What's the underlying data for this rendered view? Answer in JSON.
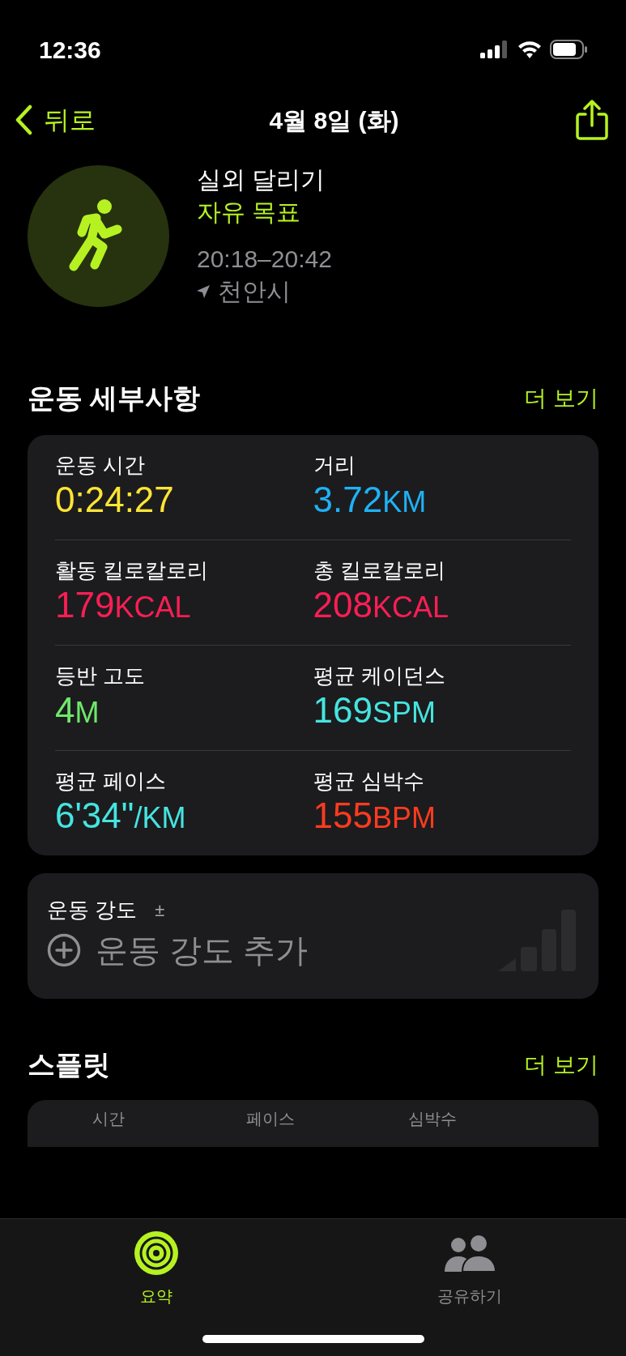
{
  "status_bar": {
    "time": "12:36"
  },
  "nav": {
    "back": "뒤로",
    "title": "4월 8일 (화)"
  },
  "workout": {
    "name": "실외 달리기",
    "goal": "자유 목표",
    "time_range": "20:18–20:42",
    "location": "천안시"
  },
  "details": {
    "title": "운동 세부사항",
    "more": "더 보기",
    "metrics": [
      {
        "label": "운동 시간",
        "value": "0:24:27",
        "color": "#ffe534"
      },
      {
        "label": "거리",
        "value": "3.72",
        "unit": "KM",
        "color": "#1fb2f5"
      },
      {
        "label": "활동 킬로칼로리",
        "value": "179",
        "unit": "KCAL",
        "color": "#fa1e54"
      },
      {
        "label": "총 킬로칼로리",
        "value": "208",
        "unit": "KCAL",
        "color": "#fa1e54"
      },
      {
        "label": "등반 고도",
        "value": "4",
        "unit": "M",
        "color": "#6fe86a"
      },
      {
        "label": "평균 케이던스",
        "value": "169",
        "unit": "SPM",
        "color": "#45e5e0"
      },
      {
        "label": "평균 페이스",
        "value": "6'34\"",
        "unit": "/KM",
        "color": "#45e5e0"
      },
      {
        "label": "평균 심박수",
        "value": "155",
        "unit": "BPM",
        "color": "#ff3b1f"
      }
    ]
  },
  "intensity": {
    "label": "운동 강도",
    "symbol": "±",
    "add": "운동 강도 추가"
  },
  "splits": {
    "title": "스플릿",
    "more": "더 보기",
    "columns": [
      "시간",
      "페이스",
      "심박수"
    ]
  },
  "tab_bar": [
    {
      "label": "요약",
      "selected": true,
      "kind": "summary"
    },
    {
      "label": "공유하기",
      "selected": false,
      "kind": "sharing"
    }
  ]
}
